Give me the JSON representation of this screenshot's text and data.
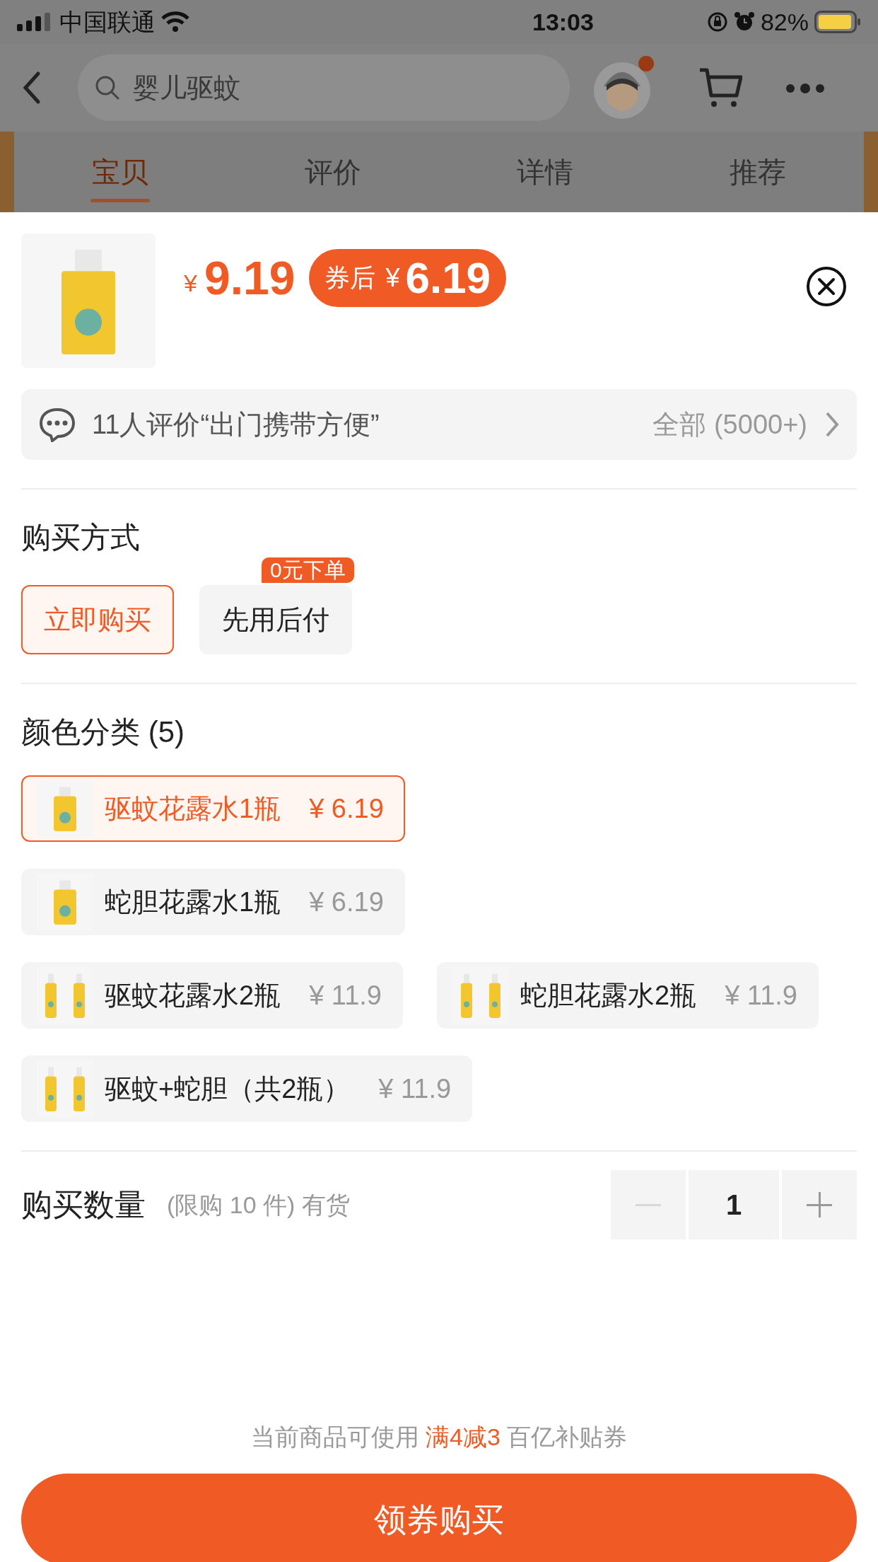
{
  "status_bar": {
    "carrier": "中国联通",
    "time": "13:03",
    "battery": "82%"
  },
  "search": {
    "placeholder": "婴儿驱蚊"
  },
  "tabs": [
    {
      "label": "宝贝",
      "selected": true
    },
    {
      "label": "评价",
      "selected": false
    },
    {
      "label": "详情",
      "selected": false
    },
    {
      "label": "推荐",
      "selected": false
    }
  ],
  "product": {
    "price_symbol": "¥",
    "price": "9.19",
    "coupon_label": "券后",
    "coupon_symbol": "¥",
    "coupon_price": "6.19"
  },
  "review": {
    "text": "11人评价“出门携带方便”",
    "all": "全部 (5000+)"
  },
  "purchase": {
    "title": "购买方式",
    "options": [
      {
        "label": "立即购买",
        "selected": true
      },
      {
        "label": "先用后付",
        "selected": false,
        "badge": "0元下单"
      }
    ]
  },
  "variants": {
    "title": "颜色分类 (5)",
    "rows": [
      {
        "items": [
          {
            "name": "驱蚊花露水1瓶",
            "price": "¥ 6.19",
            "selected": true
          }
        ]
      },
      {
        "items": [
          {
            "name": "蛇胆花露水1瓶",
            "price": "¥ 6.19",
            "selected": false
          }
        ]
      },
      {
        "items": [
          {
            "name": "驱蚊花露水2瓶",
            "price": "¥ 11.9",
            "selected": false
          },
          {
            "name": "蛇胆花露水2瓶",
            "price": "¥ 11.9",
            "selected": false
          }
        ]
      },
      {
        "items": [
          {
            "name": "驱蚊+蛇胆（共2瓶）",
            "price": "¥ 11.9",
            "selected": false
          }
        ]
      }
    ]
  },
  "quantity": {
    "label": "购买数量",
    "note": "(限购 10 件) 有货",
    "value": "1",
    "decrease_disabled": true,
    "increase_disabled": false
  },
  "footer": {
    "coupon_note": "当前商品可使用 **满4减3** 百亿补贴券",
    "button": "领券购买"
  }
}
